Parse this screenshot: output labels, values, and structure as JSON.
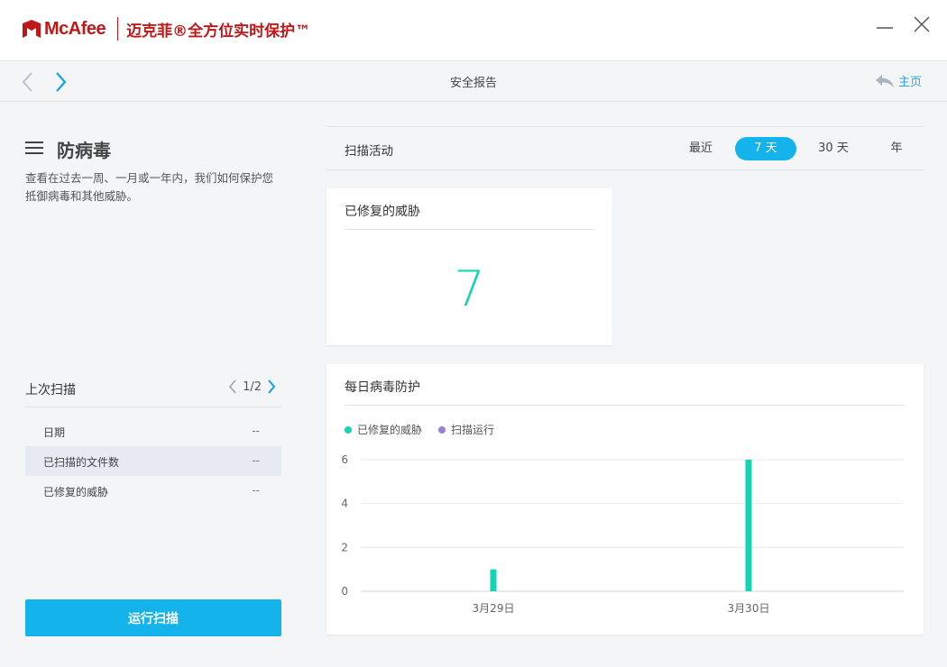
{
  "app": {
    "brand": "McAfee",
    "product": "迈克菲®全方位实时保护™"
  },
  "nav": {
    "title": "安全报告",
    "home_label": "主页"
  },
  "section": {
    "title": "防病毒",
    "description": "查看在过去一周、一月或一年内，我们如何保护您抵御病毒和其他威胁。"
  },
  "last_scan": {
    "title": "上次扫描",
    "pager": "1/2",
    "rows": [
      {
        "label": "日期",
        "value": "--"
      },
      {
        "label": "已扫描的文件数",
        "value": "--"
      },
      {
        "label": "已修复的威胁",
        "value": "--"
      }
    ]
  },
  "run_scan_label": "运行扫描",
  "activity": {
    "title": "扫描活动",
    "tabs": [
      "最近",
      "7 天",
      "30 天",
      "年"
    ],
    "active_tab": "7 天"
  },
  "threats_card": {
    "title": "已修复的威胁",
    "value": "7"
  },
  "daily_card": {
    "title": "每日病毒防护"
  },
  "colors": {
    "brand_red": "#c01818",
    "accent_blue": "#14b3eb",
    "threat_teal": "#16d3b4",
    "scan_purple": "#9b7fd9"
  },
  "chart_data": {
    "type": "bar",
    "categories": [
      "3月29日",
      "3月30日"
    ],
    "series": [
      {
        "name": "已修复的威胁",
        "values": [
          1,
          6
        ],
        "color": "#16d3b4"
      },
      {
        "name": "扫描运行",
        "values": [
          0,
          0
        ],
        "color": "#9b7fd9"
      }
    ],
    "yticks": [
      0,
      2,
      4,
      6
    ],
    "ylim": [
      0,
      6
    ],
    "grid": true,
    "legend": "top-left"
  }
}
